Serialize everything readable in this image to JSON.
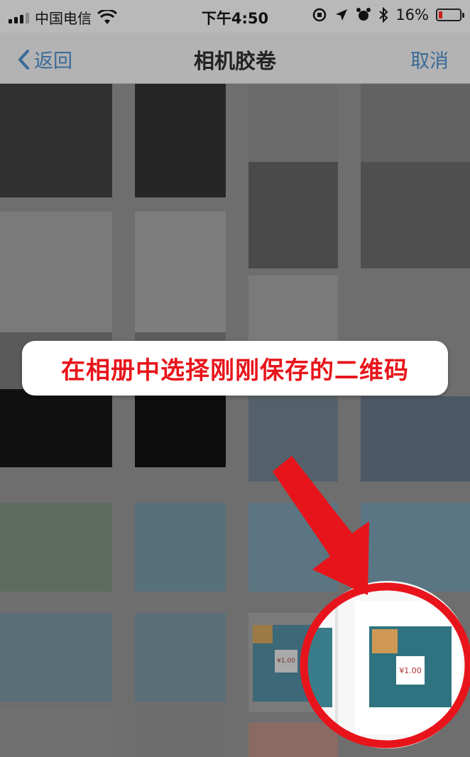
{
  "status_bar": {
    "carrier": "中国电信",
    "time": "下午4:50",
    "battery_percent": "16%"
  },
  "nav": {
    "back_label": "返回",
    "title": "相机胶卷",
    "cancel_label": "取消"
  },
  "annotation": {
    "instruction": "在相册中选择刚刚保存的二维码"
  },
  "qr_thumbnails": {
    "price_label": "¥1.00"
  },
  "colors": {
    "accent_red": "#e8141b",
    "nav_link": "#3a6a99"
  }
}
